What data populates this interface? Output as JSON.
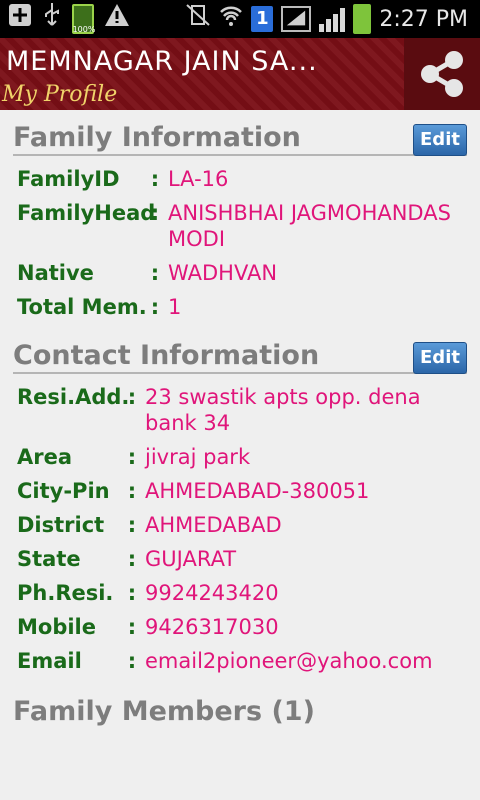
{
  "status_bar": {
    "battery_small_label": "100%",
    "sim_badge": "1",
    "time": "2:27 PM"
  },
  "action_bar": {
    "title": "MEMNAGAR JAIN SA...",
    "subtitle": "My Profile"
  },
  "family_info": {
    "title": "Family Information",
    "edit_label": "Edit",
    "rows": [
      {
        "label": "FamilyID",
        "value": "LA-16"
      },
      {
        "label": "FamilyHead",
        "value": "ANISHBHAI JAGMOHANDAS MODI"
      },
      {
        "label": "Native",
        "value": "WADHVAN"
      },
      {
        "label": "Total Mem.",
        "value": "1"
      }
    ]
  },
  "contact_info": {
    "title": "Contact Information",
    "edit_label": "Edit",
    "rows": [
      {
        "label": "Resi.Add.",
        "value": "23 swastik apts opp. dena bank 34"
      },
      {
        "label": "Area",
        "value": "jivraj park"
      },
      {
        "label": "City-Pin",
        "value": "AHMEDABAD-380051"
      },
      {
        "label": "District",
        "value": "AHMEDABAD"
      },
      {
        "label": "State",
        "value": "GUJARAT"
      },
      {
        "label": "Ph.Resi.",
        "value": "9924243420"
      },
      {
        "label": "Mobile",
        "value": "9426317030"
      },
      {
        "label": "Email",
        "value": "email2pioneer@yahoo.com"
      }
    ]
  },
  "family_members": {
    "title": "Family Members (1)"
  },
  "colors": {
    "label_green": "#1a6a1a",
    "value_pink": "#e0157a",
    "header_maroon": "#7a0f16"
  }
}
